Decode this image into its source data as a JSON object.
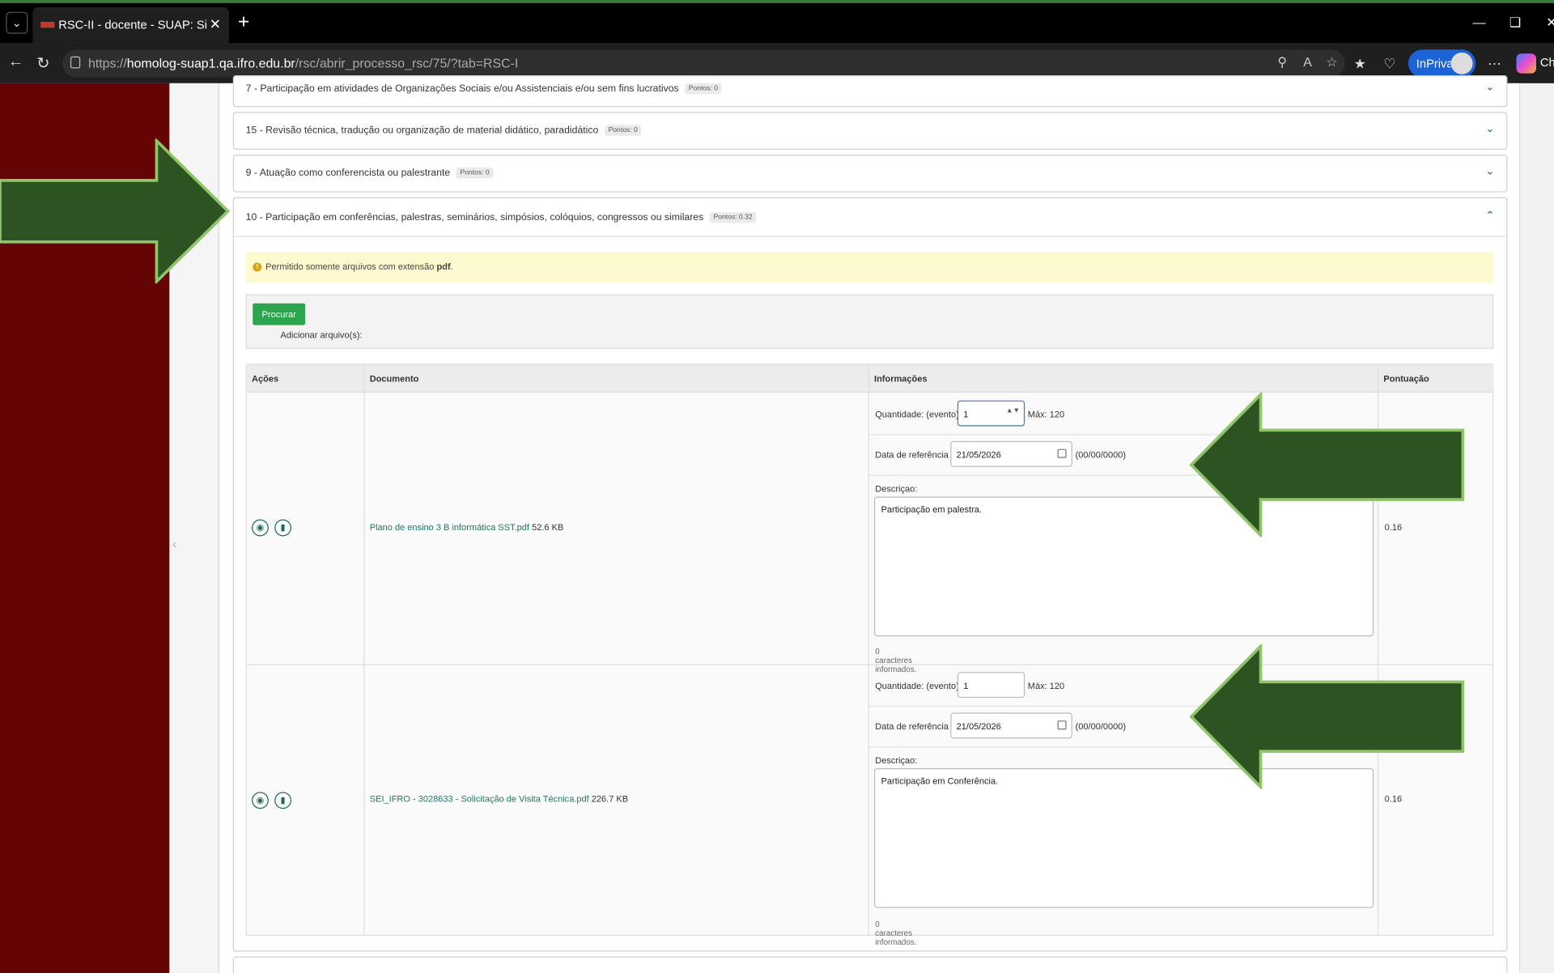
{
  "browser": {
    "tab_title": "RSC-II - docente - SUAP: Sistema U",
    "url_prefix": "https://",
    "url_host": "homolog-suap1.qa.ifro.edu.br",
    "url_path": "/rsc/abrir_processo_rsc/75/?tab=RSC-I",
    "inprivate_label": "InPrivate",
    "copilot_label": "Ch"
  },
  "sections": [
    {
      "title": "7 - Participação em atividades de Organizações Sociais e/ou Assistenciais e/ou sem fins lucrativos",
      "points": "Pontos: 0"
    },
    {
      "title": "15 - Revisão técnica, tradução ou organização de material didático, paradidático",
      "points": "Pontos: 0"
    },
    {
      "title": "9 - Atuação como conferencista ou palestrante",
      "points": "Pontos: 0"
    },
    {
      "title": "10 - Participação em conferências, palestras, seminários, simpósios, colóquios, congressos ou similares",
      "points": "Pontos: 0.32"
    }
  ],
  "notice": {
    "text": "Permitido somente arquivos com extensão ",
    "ext": "pdf",
    "end": "."
  },
  "upload": {
    "button": "Procurar",
    "label": "Adicionar arquivo(s):"
  },
  "table": {
    "headers": [
      "Ações",
      "Documento",
      "Informações",
      "Pontuação"
    ],
    "rows": [
      {
        "doc_name": "Plano de ensino 3 B informática SST.pdf",
        "doc_size": " 52.6 KB",
        "qty_label": "Quantidade: (evento):",
        "qty_value": "1",
        "max_label": "Máx: 120",
        "date_label": "Data de referência :",
        "date_value": "21/05/2026",
        "date_hint": "(00/00/0000)",
        "desc_label": "Descriçao:",
        "desc_value": "Participação em palestra.",
        "chars": "0 caracteres informados.",
        "score": "0.16"
      },
      {
        "doc_name": "SEI_IFRO - 3028633 - Solicitação de Visita Técnica.pdf",
        "doc_size": " 226.7 KB",
        "qty_label": "Quantidade: (evento):",
        "qty_value": "1",
        "max_label": "Máx: 120",
        "date_label": "Data de referência :",
        "date_value": "21/05/2026",
        "date_hint": "(00/00/0000)",
        "desc_label": "Descriçao:",
        "desc_value": "Participação em Conferência.",
        "chars": "0 caracteres informados.",
        "score": "0.16"
      }
    ]
  },
  "colors": {
    "sidebar": "#650404",
    "accent_green": "#2da44e",
    "arrow_fill": "#2e5322",
    "arrow_stroke": "#8fc46a"
  }
}
